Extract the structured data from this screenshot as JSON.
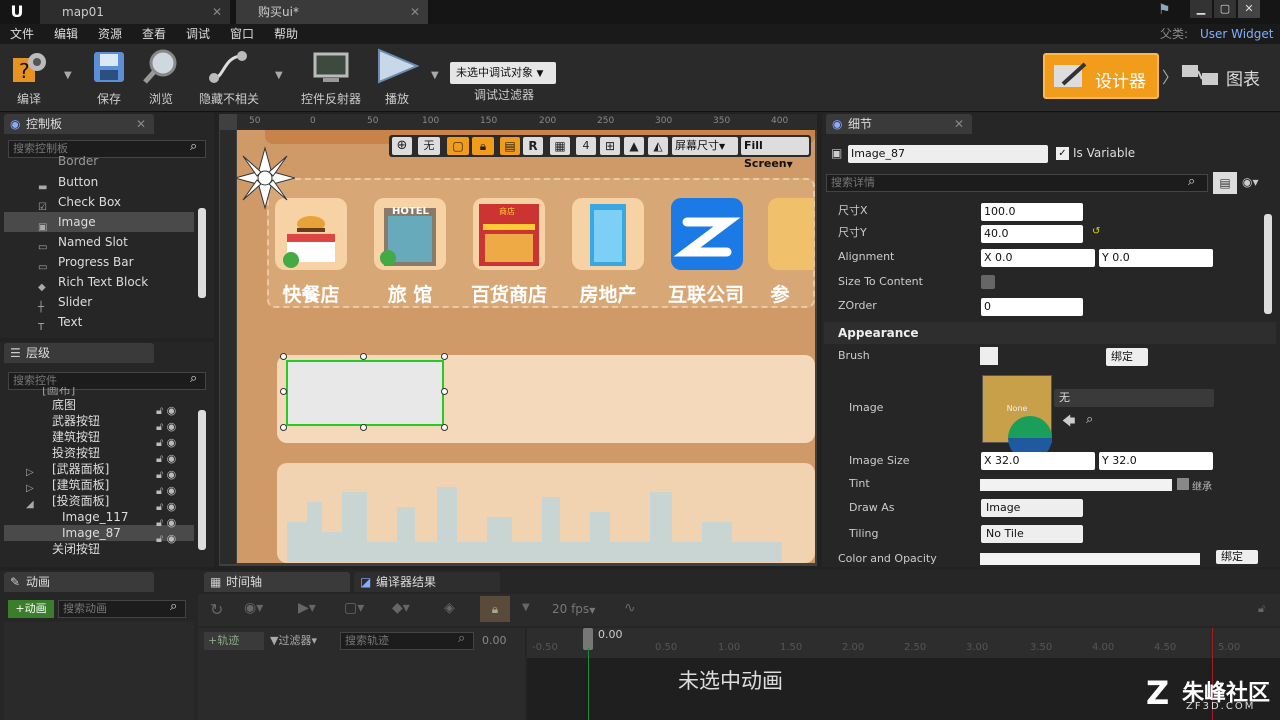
{
  "tabs": {
    "map": "map01",
    "widget": "购买ui*"
  },
  "window": {
    "parent_label": "父类:",
    "parent_value": "User Widget"
  },
  "menu": [
    "文件",
    "编辑",
    "资源",
    "查看",
    "调试",
    "窗口",
    "帮助"
  ],
  "toolbar": {
    "compile": "编译",
    "save": "保存",
    "browse": "浏览",
    "hide_unrelated": "隐藏不相关",
    "reflector": "控件反射器",
    "play": "播放",
    "debug_select": "未选中调试对象",
    "debug_filter": "调试过滤器",
    "designer": "设计器",
    "graph": "图表"
  },
  "palette": {
    "tab": "控制板",
    "search_placeholder": "搜索控制板",
    "items": [
      "Border",
      "Button",
      "Check Box",
      "Image",
      "Named Slot",
      "Progress Bar",
      "Rich Text Block",
      "Slider",
      "Text"
    ]
  },
  "hierarchy": {
    "tab": "层级",
    "search_placeholder": "搜索控件",
    "items": [
      "[画布]",
      "底图",
      "武器按钮",
      "建筑按钮",
      "投资按钮",
      "[武器面板]",
      "[建筑面板]",
      "[投资面板]",
      "Image_117",
      "Image_87",
      "关闭按钮"
    ]
  },
  "canvas": {
    "ruler_top": [
      "50",
      "0",
      "50",
      "100",
      "150",
      "200",
      "250",
      "300",
      "350",
      "400",
      "450"
    ],
    "toolbar": {
      "none": "无",
      "r": "R",
      "grid": "4",
      "screen_size": "屏幕尺寸",
      "fill": "Fill Screen"
    },
    "shops": [
      "快餐店",
      "旅 馆",
      "百货商店",
      "房地产",
      "互联公司",
      "参"
    ],
    "hotel_sign": "HOTEL",
    "store_sign": "商店"
  },
  "details": {
    "tab": "细节",
    "name": "Image_87",
    "is_variable": "Is Variable",
    "search_placeholder": "搜索详情",
    "size_x_label": "尺寸X",
    "size_x": "100.0",
    "size_y_label": "尺寸Y",
    "size_y": "40.0",
    "alignment": "Alignment",
    "align_x": "X  0.0",
    "align_y": "Y  0.0",
    "size_to_content": "Size To Content",
    "zorder": "ZOrder",
    "zorder_val": "0",
    "appearance": "Appearance",
    "brush": "Brush",
    "bind": "绑定",
    "image": "Image",
    "image_thumb": "None",
    "image_value": "无",
    "image_size": "Image Size",
    "img_x": "X  32.0",
    "img_y": "Y  32.0",
    "tint": "Tint",
    "inherit": "继承",
    "draw_as": "Draw As",
    "draw_as_val": "Image",
    "tiling": "Tiling",
    "tiling_val": "No Tile",
    "color_opacity": "Color and Opacity",
    "bind2": "绑定"
  },
  "bottom": {
    "anim_tab": "动画",
    "add_anim": "+动画",
    "anim_search": "搜索动画",
    "timeline_tab": "时间轴",
    "compiler_tab": "编译器结果",
    "fps": "20 fps",
    "track": "+轨迹",
    "filter": "过滤器",
    "track_search": "搜索轨迹",
    "time": "0.00",
    "ticks": [
      "-0.50",
      "0.00",
      "0.50",
      "1.00",
      "1.50",
      "2.00",
      "2.50",
      "3.00",
      "3.50",
      "4.00",
      "4.50",
      "5.00"
    ],
    "no_anim": "未选中动画"
  },
  "watermark": {
    "name": "朱峰社区",
    "url": "ZF3D.COM"
  },
  "colors": {
    "accent": "#f19c1a",
    "selection": "#22cc22",
    "bg": "#222222"
  }
}
